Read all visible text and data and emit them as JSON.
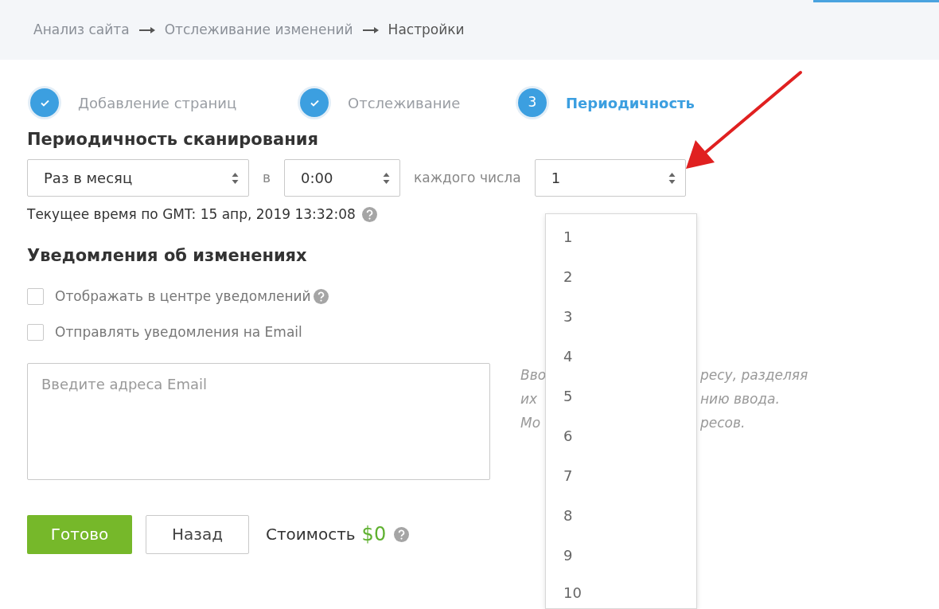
{
  "breadcrumb": [
    {
      "label": "Анализ сайта",
      "current": false
    },
    {
      "label": "Отслеживание изменений",
      "current": false
    },
    {
      "label": "Настройки",
      "current": true
    }
  ],
  "steps": [
    {
      "label": "Добавление страниц",
      "kind": "done"
    },
    {
      "label": "Отслеживание",
      "kind": "done"
    },
    {
      "number": "3",
      "label": "Периодичность",
      "kind": "current"
    }
  ],
  "scan": {
    "title": "Периодичность сканирования",
    "frequency": {
      "value": "Раз в месяц"
    },
    "at_label": "в",
    "time": {
      "value": "0:00"
    },
    "day_label": "каждого числа",
    "day": {
      "value": "1",
      "expanded": true,
      "options": [
        "1",
        "2",
        "3",
        "4",
        "5",
        "6",
        "7",
        "8",
        "9",
        "10"
      ]
    },
    "current_time": "Текущее время по GMT: 15 апр, 2019 13:32:08",
    "current_time_help": true
  },
  "notifications": {
    "title": "Уведомления об изменениях",
    "options": [
      {
        "label": "Отображать в центре уведомлений",
        "checked": false,
        "help": true
      },
      {
        "label": "Отправлять уведомления на Email",
        "checked": false,
        "help": false
      }
    ],
    "email": {
      "placeholder": "Введите адреса Email"
    },
    "hint_lines": [
      {
        "left": "Вво",
        "right": "ресу, разделяя"
      },
      {
        "left": "их",
        "right": "нию ввода."
      },
      {
        "left": "Мо",
        "right": "ресов."
      }
    ]
  },
  "footer": {
    "buttons": [
      {
        "label": "Готово",
        "kind": "primary"
      },
      {
        "label": "Назад",
        "kind": "secondary"
      }
    ],
    "cost_label": "Стоимость",
    "cost_value": "$0",
    "cost_help": true
  }
}
